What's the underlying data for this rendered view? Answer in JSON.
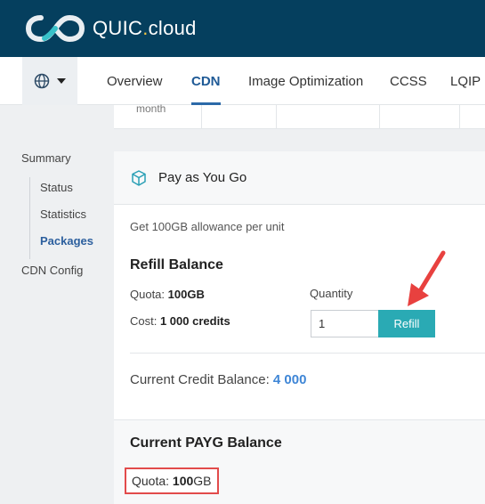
{
  "header": {
    "brand": "QUIC",
    "brand_dot": ".",
    "brand_suffix": "cloud",
    "logo_icon": "infinity-logo-icon"
  },
  "nav": {
    "language_icon": "globe-icon",
    "tabs": [
      {
        "label": "Overview",
        "active": false
      },
      {
        "label": "CDN",
        "active": true
      },
      {
        "label": "Image Optimization",
        "active": false
      },
      {
        "label": "CCSS",
        "active": false
      },
      {
        "label": "LQIP",
        "active": false
      }
    ]
  },
  "top_card": {
    "fragment": "month"
  },
  "sidebar": {
    "summary": "Summary",
    "items": [
      "Status",
      "Statistics",
      "Packages"
    ],
    "active_item": "Packages",
    "cdn_config": "CDN Config"
  },
  "payg": {
    "title": "Pay as You Go",
    "icon": "cube-icon",
    "allowance": "Get 100GB allowance per unit",
    "refill_title": "Refill Balance",
    "quota_label": "Quota:",
    "quota_value": "100GB",
    "cost_label": "Cost:",
    "cost_value": "1 000 credits",
    "quantity_label": "Quantity",
    "quantity_value": "1",
    "refill_button": "Refill",
    "credit_label": "Current Credit Balance:",
    "credit_value": "4 000",
    "current_title": "Current PAYG Balance",
    "current_quota_label": "Quota:",
    "current_quota_value": "100",
    "current_quota_unit": "GB"
  },
  "colors": {
    "header_bg": "#053f5e",
    "accent": "#2aaab4",
    "link": "#3f86d6",
    "highlight": "#e24b4b"
  }
}
